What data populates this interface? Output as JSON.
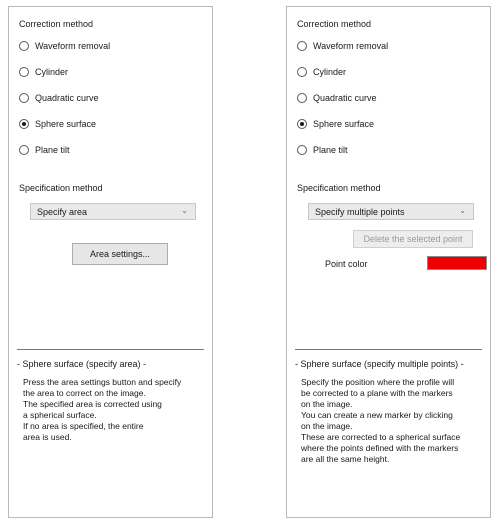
{
  "left": {
    "correction_method_title": "Correction method",
    "options": [
      {
        "label": "Waveform removal",
        "checked": false
      },
      {
        "label": "Cylinder",
        "checked": false
      },
      {
        "label": "Quadratic curve",
        "checked": false
      },
      {
        "label": "Sphere surface",
        "checked": true
      },
      {
        "label": "Plane tilt",
        "checked": false
      }
    ],
    "specification_method_title": "Specification method",
    "specification_value": "Specify area",
    "area_settings_button": "Area settings...",
    "description_title": "- Sphere surface (specify area) -",
    "description_lines": [
      "Press the area settings button and specify",
      "the area to correct on the image.",
      "The specified area is corrected using",
      "a spherical surface.",
      "If no area is specified, the entire",
      "area is used."
    ]
  },
  "right": {
    "correction_method_title": "Correction method",
    "options": [
      {
        "label": "Waveform removal",
        "checked": false
      },
      {
        "label": "Cylinder",
        "checked": false
      },
      {
        "label": "Quadratic curve",
        "checked": false
      },
      {
        "label": "Sphere surface",
        "checked": true
      },
      {
        "label": "Plane tilt",
        "checked": false
      }
    ],
    "specification_method_title": "Specification method",
    "specification_value": "Specify multiple points",
    "delete_point_button": "Delete the selected point",
    "point_color_label": "Point color",
    "point_color": "#ee0000",
    "description_title": "- Sphere surface (specify multiple points) -",
    "description_lines": [
      "Specify the position where the profile will",
      "be corrected to a plane with the markers",
      "on the image.",
      "You can create a new marker by clicking",
      "on the image.",
      "These are corrected to a spherical surface",
      "where the points defined with the markers",
      "are all the same height."
    ]
  },
  "icons": {
    "dropdown": "chevron-down-icon"
  }
}
